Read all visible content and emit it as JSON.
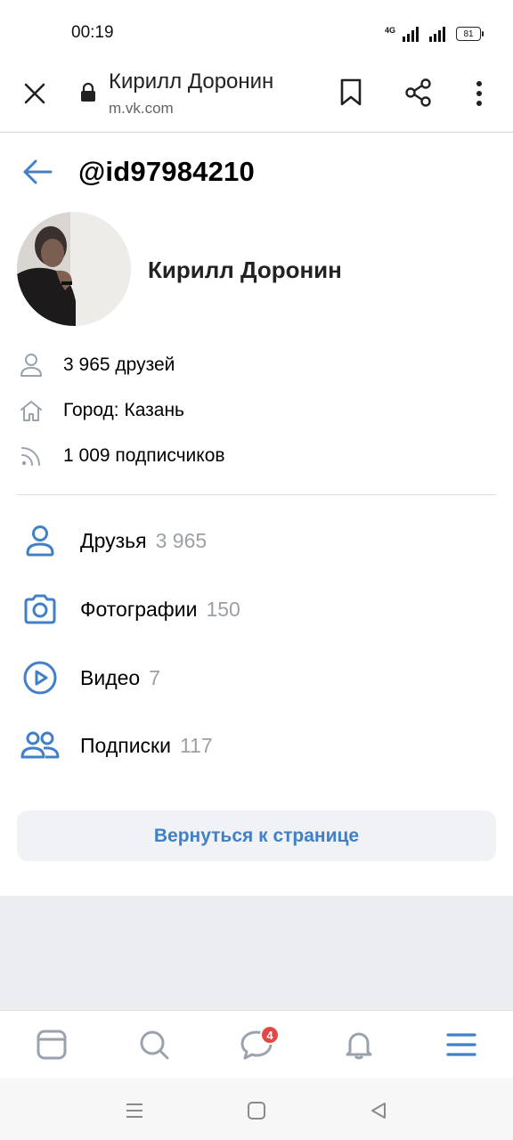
{
  "status_bar": {
    "time": "00:19",
    "network": "4G",
    "battery": "81"
  },
  "browser": {
    "title": "Кирилл Доронин",
    "url": "m.vk.com"
  },
  "profile": {
    "handle": "@id97984210",
    "name": "Кирилл Доронин",
    "info": [
      {
        "icon": "person-icon",
        "text": "3 965 друзей"
      },
      {
        "icon": "home-icon",
        "text": "Город: Казань"
      },
      {
        "icon": "rss-icon",
        "text": "1 009 подписчиков"
      }
    ]
  },
  "menu": [
    {
      "icon": "friends-icon",
      "label": "Друзья",
      "count": "3 965"
    },
    {
      "icon": "camera-icon",
      "label": "Фотографии",
      "count": "150"
    },
    {
      "icon": "video-play-icon",
      "label": "Видео",
      "count": "7"
    },
    {
      "icon": "subscriptions-icon",
      "label": "Подписки",
      "count": "117"
    }
  ],
  "back_button": "Вернуться к странице",
  "tabbar": {
    "messages_badge": "4"
  },
  "colors": {
    "accent": "#3f80c8",
    "badge": "#e64646",
    "count": "#9aa0a6"
  }
}
